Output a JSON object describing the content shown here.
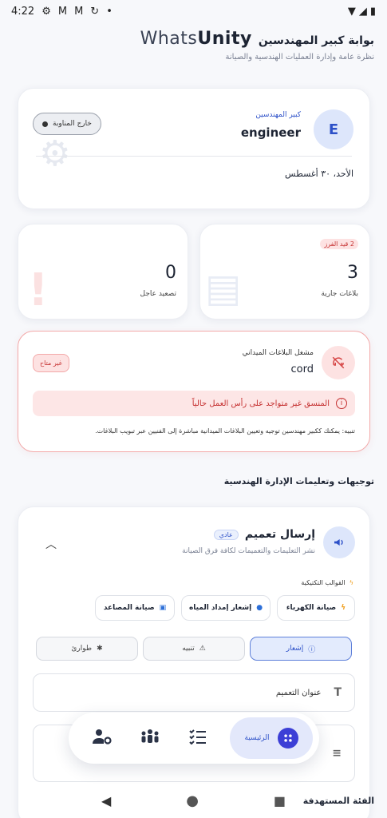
{
  "status_bar": {
    "time": "4:22"
  },
  "header": {
    "brand_prefix": "Whats",
    "brand_suffix": "Unity",
    "title": "بوابة كبير المهندسين",
    "subtitle": "نظرة عامة وإدارة العمليات الهندسية والصيانة"
  },
  "profile": {
    "avatar_letter": "E",
    "role": "كبير المهندسين",
    "username": "engineer",
    "shift_button": "خارج المناوبة",
    "date": "الأحد، ٣٠ أغسطس"
  },
  "stats": {
    "active": {
      "value": "3",
      "label": "بلاغات جارية",
      "badge": "2 قيد الفرز"
    },
    "urgent": {
      "value": "0",
      "label": "تصعيد عاجل"
    }
  },
  "dispatcher": {
    "role": "مشغل البلاغات الميداني",
    "name": "cord",
    "status": "غير متاح",
    "alert": "المنسق غير متواجد على رأس العمل حالياً",
    "notice": "تنبيه: يمكنك ككبير مهندسين توجيه وتعيين البلاغات الميدانية مباشرة إلى الفنيين عبر تبويب البلاغات."
  },
  "section": {
    "title": "توجيهات وتعليمات الإدارة الهندسية"
  },
  "broadcast": {
    "title": "إرسال تعميم",
    "tag": "عادي",
    "subtitle": "نشر التعليمات والتعميمات لكافة فرق الصيانة",
    "templates_label": "القوالب التكتيكية",
    "templates": [
      "صيانة الكهرباء",
      "إشعار إمداد المياه",
      "صيانة المصاعد"
    ],
    "types": [
      "إشعار",
      "تنبيه",
      "طوارئ"
    ],
    "title_placeholder": "عنوان التعميم",
    "category_label": "الفئة المستهدفة"
  },
  "nav": {
    "home_label": "الرئيسية"
  },
  "colors": {
    "accent": "#2c50c8",
    "danger": "#c53030",
    "nav_accent": "#3c3fd6"
  }
}
